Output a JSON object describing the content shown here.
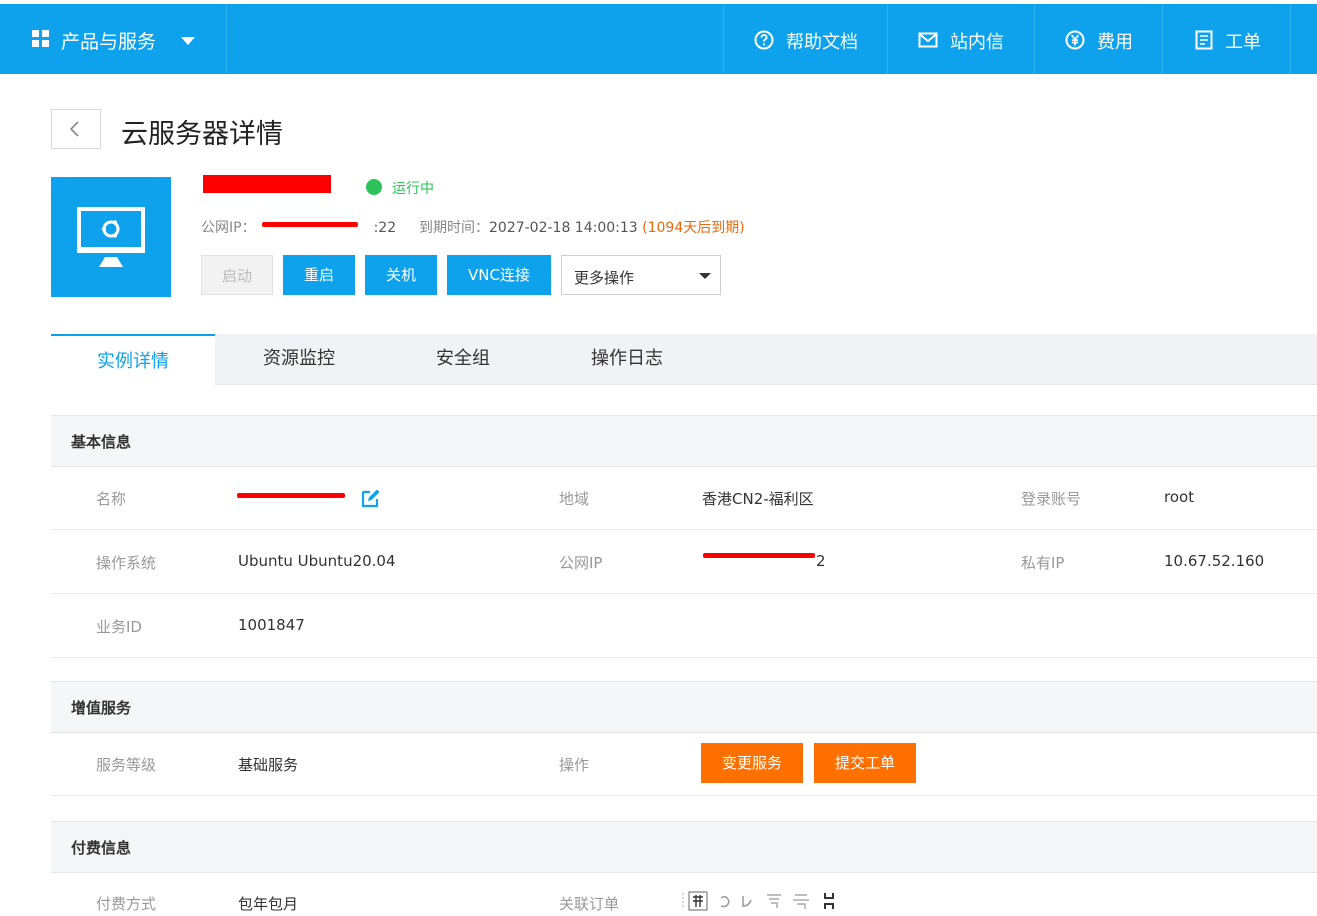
{
  "topnav": {
    "products_label": "产品与服务",
    "items": [
      {
        "label": "帮助文档",
        "icon": "help-circle-icon"
      },
      {
        "label": "站内信",
        "icon": "mail-icon"
      },
      {
        "label": "费用",
        "icon": "yuan-icon"
      },
      {
        "label": "工单",
        "icon": "ticket-icon"
      }
    ]
  },
  "header": {
    "title": "云服务器详情"
  },
  "server": {
    "status": "运行中",
    "public_ip_label": "公网IP：",
    "public_ip_suffix": ":22",
    "expire_label": "到期时间：",
    "expire_time": "2027-02-18 14:00:13",
    "expire_remaining": "(1094天后到期)"
  },
  "actions": {
    "start": "启动",
    "restart": "重启",
    "shutdown": "关机",
    "vnc": "VNC连接",
    "more": "更多操作"
  },
  "tabs": [
    "实例详情",
    "资源监控",
    "安全组",
    "操作日志"
  ],
  "basic": {
    "title": "基本信息",
    "name_label": "名称",
    "region_label": "地域",
    "region": "香港CN2-福利区",
    "login_label": "登录账号",
    "login": "root",
    "os_label": "操作系统",
    "os": "Ubuntu Ubuntu20.04",
    "public_ip_label": "公网IP",
    "public_ip_tail": "2",
    "private_ip_label": "私有IP",
    "private_ip": "10.67.52.160",
    "biz_id_label": "业务ID",
    "biz_id": "1001847"
  },
  "value_added": {
    "title": "增值服务",
    "level_label": "服务等级",
    "level": "基础服务",
    "op_label": "操作",
    "change_btn": "变更服务",
    "ticket_btn": "提交工单"
  },
  "billing": {
    "title": "付费信息",
    "method_label": "付费方式",
    "method": "包年包月",
    "order_label": "关联订单"
  },
  "colors": {
    "primary": "#0ea2ec",
    "running": "#2ec25a",
    "warning": "#e86a0c",
    "orange_button": "#ff7000",
    "redaction": "#ff0000"
  }
}
